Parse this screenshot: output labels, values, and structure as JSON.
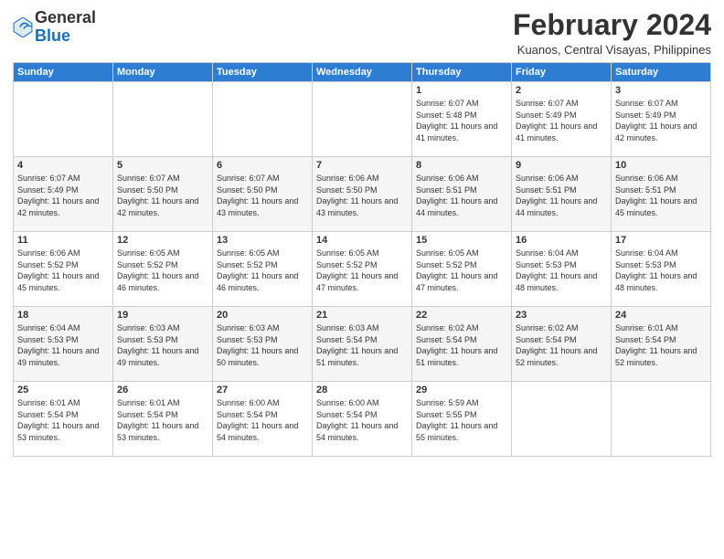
{
  "header": {
    "logo": {
      "general": "General",
      "blue": "Blue"
    },
    "title": "February 2024",
    "location": "Kuanos, Central Visayas, Philippines"
  },
  "days_of_week": [
    "Sunday",
    "Monday",
    "Tuesday",
    "Wednesday",
    "Thursday",
    "Friday",
    "Saturday"
  ],
  "weeks": [
    [
      {
        "day": "",
        "sunrise": "",
        "sunset": "",
        "daylight": ""
      },
      {
        "day": "",
        "sunrise": "",
        "sunset": "",
        "daylight": ""
      },
      {
        "day": "",
        "sunrise": "",
        "sunset": "",
        "daylight": ""
      },
      {
        "day": "",
        "sunrise": "",
        "sunset": "",
        "daylight": ""
      },
      {
        "day": "1",
        "sunrise": "6:07 AM",
        "sunset": "5:48 PM",
        "daylight": "11 hours and 41 minutes."
      },
      {
        "day": "2",
        "sunrise": "6:07 AM",
        "sunset": "5:49 PM",
        "daylight": "11 hours and 41 minutes."
      },
      {
        "day": "3",
        "sunrise": "6:07 AM",
        "sunset": "5:49 PM",
        "daylight": "11 hours and 42 minutes."
      }
    ],
    [
      {
        "day": "4",
        "sunrise": "6:07 AM",
        "sunset": "5:49 PM",
        "daylight": "11 hours and 42 minutes."
      },
      {
        "day": "5",
        "sunrise": "6:07 AM",
        "sunset": "5:50 PM",
        "daylight": "11 hours and 42 minutes."
      },
      {
        "day": "6",
        "sunrise": "6:07 AM",
        "sunset": "5:50 PM",
        "daylight": "11 hours and 43 minutes."
      },
      {
        "day": "7",
        "sunrise": "6:06 AM",
        "sunset": "5:50 PM",
        "daylight": "11 hours and 43 minutes."
      },
      {
        "day": "8",
        "sunrise": "6:06 AM",
        "sunset": "5:51 PM",
        "daylight": "11 hours and 44 minutes."
      },
      {
        "day": "9",
        "sunrise": "6:06 AM",
        "sunset": "5:51 PM",
        "daylight": "11 hours and 44 minutes."
      },
      {
        "day": "10",
        "sunrise": "6:06 AM",
        "sunset": "5:51 PM",
        "daylight": "11 hours and 45 minutes."
      }
    ],
    [
      {
        "day": "11",
        "sunrise": "6:06 AM",
        "sunset": "5:52 PM",
        "daylight": "11 hours and 45 minutes."
      },
      {
        "day": "12",
        "sunrise": "6:05 AM",
        "sunset": "5:52 PM",
        "daylight": "11 hours and 46 minutes."
      },
      {
        "day": "13",
        "sunrise": "6:05 AM",
        "sunset": "5:52 PM",
        "daylight": "11 hours and 46 minutes."
      },
      {
        "day": "14",
        "sunrise": "6:05 AM",
        "sunset": "5:52 PM",
        "daylight": "11 hours and 47 minutes."
      },
      {
        "day": "15",
        "sunrise": "6:05 AM",
        "sunset": "5:52 PM",
        "daylight": "11 hours and 47 minutes."
      },
      {
        "day": "16",
        "sunrise": "6:04 AM",
        "sunset": "5:53 PM",
        "daylight": "11 hours and 48 minutes."
      },
      {
        "day": "17",
        "sunrise": "6:04 AM",
        "sunset": "5:53 PM",
        "daylight": "11 hours and 48 minutes."
      }
    ],
    [
      {
        "day": "18",
        "sunrise": "6:04 AM",
        "sunset": "5:53 PM",
        "daylight": "11 hours and 49 minutes."
      },
      {
        "day": "19",
        "sunrise": "6:03 AM",
        "sunset": "5:53 PM",
        "daylight": "11 hours and 49 minutes."
      },
      {
        "day": "20",
        "sunrise": "6:03 AM",
        "sunset": "5:53 PM",
        "daylight": "11 hours and 50 minutes."
      },
      {
        "day": "21",
        "sunrise": "6:03 AM",
        "sunset": "5:54 PM",
        "daylight": "11 hours and 51 minutes."
      },
      {
        "day": "22",
        "sunrise": "6:02 AM",
        "sunset": "5:54 PM",
        "daylight": "11 hours and 51 minutes."
      },
      {
        "day": "23",
        "sunrise": "6:02 AM",
        "sunset": "5:54 PM",
        "daylight": "11 hours and 52 minutes."
      },
      {
        "day": "24",
        "sunrise": "6:01 AM",
        "sunset": "5:54 PM",
        "daylight": "11 hours and 52 minutes."
      }
    ],
    [
      {
        "day": "25",
        "sunrise": "6:01 AM",
        "sunset": "5:54 PM",
        "daylight": "11 hours and 53 minutes."
      },
      {
        "day": "26",
        "sunrise": "6:01 AM",
        "sunset": "5:54 PM",
        "daylight": "11 hours and 53 minutes."
      },
      {
        "day": "27",
        "sunrise": "6:00 AM",
        "sunset": "5:54 PM",
        "daylight": "11 hours and 54 minutes."
      },
      {
        "day": "28",
        "sunrise": "6:00 AM",
        "sunset": "5:54 PM",
        "daylight": "11 hours and 54 minutes."
      },
      {
        "day": "29",
        "sunrise": "5:59 AM",
        "sunset": "5:55 PM",
        "daylight": "11 hours and 55 minutes."
      },
      {
        "day": "",
        "sunrise": "",
        "sunset": "",
        "daylight": ""
      },
      {
        "day": "",
        "sunrise": "",
        "sunset": "",
        "daylight": ""
      }
    ]
  ]
}
